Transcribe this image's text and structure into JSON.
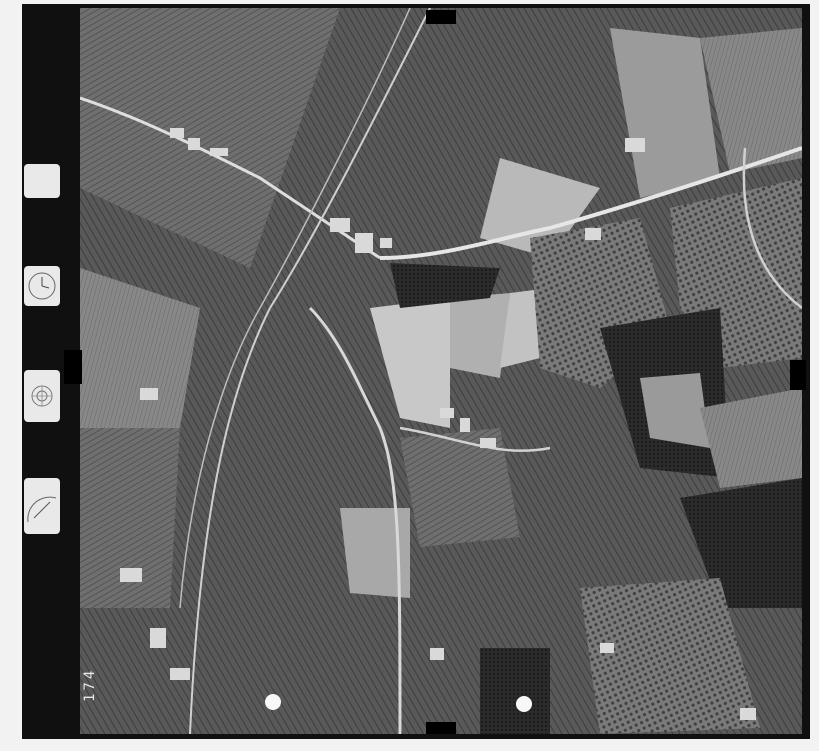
{
  "image": {
    "kind": "Aerial black-and-white survey photograph of agricultural fields, farm buildings, roads and a railway line",
    "frame_number": "174",
    "gauges": {
      "level_bubble_text": "",
      "clock_text": "",
      "altimeter_top_text": "",
      "altimeter_bottom_text": ""
    }
  }
}
